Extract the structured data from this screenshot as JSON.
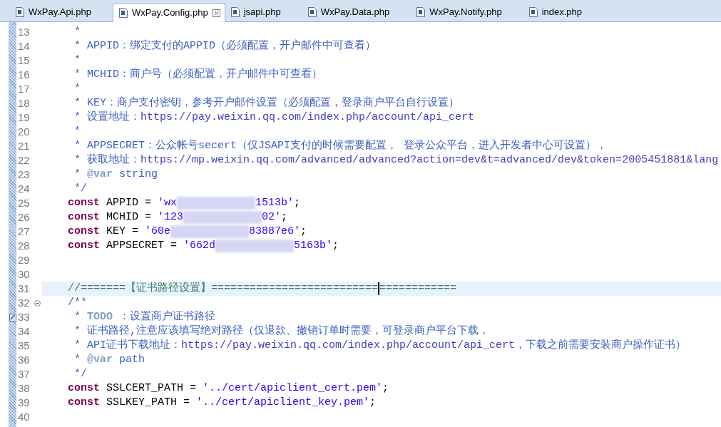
{
  "tabs": [
    {
      "label": "WxPay.Api.php",
      "selected": false
    },
    {
      "label": "WxPay.Config.php",
      "selected": true
    },
    {
      "label": "jsapi.php",
      "selected": false
    },
    {
      "label": "WxPay.Data.php",
      "selected": false
    },
    {
      "label": "WxPay.Notify.php",
      "selected": false
    },
    {
      "label": "index.php",
      "selected": false
    }
  ],
  "lines": [
    {
      "number": "13",
      "kind": "doc",
      "current": false,
      "task": false,
      "tokens": [
        {
          "kind": "doc",
          "text": "*"
        }
      ]
    },
    {
      "number": "14",
      "kind": "doc",
      "current": false,
      "task": false,
      "tokens": [
        {
          "kind": "doc",
          "text": "* APPID：绑定支付的APPID（必须配置，开户邮件中可查看）"
        }
      ]
    },
    {
      "number": "15",
      "kind": "doc",
      "current": false,
      "task": false,
      "tokens": [
        {
          "kind": "doc",
          "text": "*"
        }
      ]
    },
    {
      "number": "16",
      "kind": "doc",
      "current": false,
      "task": false,
      "tokens": [
        {
          "kind": "doc",
          "text": "* MCHID：商户号（必须配置，开户邮件中可查看）"
        }
      ]
    },
    {
      "number": "17",
      "kind": "doc",
      "current": false,
      "task": false,
      "tokens": [
        {
          "kind": "doc",
          "text": "*"
        }
      ]
    },
    {
      "number": "18",
      "kind": "doc",
      "current": false,
      "task": false,
      "tokens": [
        {
          "kind": "doc",
          "text": "* KEY：商户支付密钥，参考开户邮件设置（必须配置，登录商户平台自行设置）"
        }
      ]
    },
    {
      "number": "19",
      "kind": "doc",
      "current": false,
      "task": false,
      "tokens": [
        {
          "kind": "doc",
          "text": "* 设置地址："
        },
        {
          "kind": "url",
          "text": "https://pay.weixin.qq.com/index.php/account/api_cert"
        }
      ]
    },
    {
      "number": "20",
      "kind": "doc",
      "current": false,
      "task": false,
      "tokens": [
        {
          "kind": "doc",
          "text": "*"
        }
      ]
    },
    {
      "number": "21",
      "kind": "doc",
      "current": false,
      "task": false,
      "tokens": [
        {
          "kind": "doc",
          "text": "* APPSECRET：公众帐号secert（仅JSAPI支付的时候需要配置， 登录公众平台，进入开发者中心可设置），"
        }
      ]
    },
    {
      "number": "22",
      "kind": "doc",
      "current": false,
      "task": false,
      "tokens": [
        {
          "kind": "doc",
          "text": "* 获取地址："
        },
        {
          "kind": "url",
          "text": "https://mp.weixin.qq.com/advanced/advanced?action=dev&t=advanced/dev&token=2005451881&lang"
        }
      ]
    },
    {
      "number": "23",
      "kind": "doc",
      "current": false,
      "task": false,
      "tokens": [
        {
          "kind": "doc",
          "text": "*"
        },
        {
          "kind": "tag",
          "text": "@var"
        },
        {
          "kind": "doc",
          "text": "string"
        }
      ]
    },
    {
      "number": "24",
      "kind": "doc",
      "current": false,
      "task": false,
      "tokens": [
        {
          "kind": "doc",
          "text": "*/"
        }
      ]
    },
    {
      "number": "25",
      "kind": "code",
      "current": false,
      "task": false,
      "tokens": [
        {
          "kind": "keyword",
          "text": "const"
        },
        {
          "kind": "plain",
          "text": " APPID = "
        },
        {
          "kind": "string",
          "text": "'wx"
        },
        {
          "kind": "redacted"
        },
        {
          "kind": "string",
          "text": "1513b'"
        },
        {
          "kind": "plain",
          "text": ";"
        }
      ]
    },
    {
      "number": "26",
      "kind": "code",
      "current": false,
      "task": false,
      "tokens": [
        {
          "kind": "keyword",
          "text": "const"
        },
        {
          "kind": "plain",
          "text": " MCHID = "
        },
        {
          "kind": "string",
          "text": "'123"
        },
        {
          "kind": "redacted"
        },
        {
          "kind": "string",
          "text": "02'"
        },
        {
          "kind": "plain",
          "text": ";"
        }
      ]
    },
    {
      "number": "27",
      "kind": "code",
      "current": false,
      "task": false,
      "tokens": [
        {
          "kind": "keyword",
          "text": "const"
        },
        {
          "kind": "plain",
          "text": " KEY = "
        },
        {
          "kind": "string",
          "text": "'60e"
        },
        {
          "kind": "redacted"
        },
        {
          "kind": "string",
          "text": "83887e6'"
        },
        {
          "kind": "plain",
          "text": ";"
        }
      ]
    },
    {
      "number": "28",
      "kind": "code",
      "current": false,
      "task": false,
      "tokens": [
        {
          "kind": "keyword",
          "text": "const"
        },
        {
          "kind": "plain",
          "text": " APPSECRET = "
        },
        {
          "kind": "string",
          "text": "'662d"
        },
        {
          "kind": "redacted"
        },
        {
          "kind": "string",
          "text": "5163b'"
        },
        {
          "kind": "plain",
          "text": ";"
        }
      ]
    },
    {
      "number": "29",
      "kind": "code",
      "current": false,
      "task": false
    },
    {
      "number": "30",
      "kind": "code",
      "current": false,
      "task": false
    },
    {
      "number": "31",
      "kind": "code",
      "current": true,
      "task": false,
      "tokens": [
        {
          "kind": "comment",
          "text": "//=======【证书路径设置】=========================="
        },
        {
          "kind": "caret"
        },
        {
          "kind": "comment",
          "text": "============"
        }
      ]
    },
    {
      "number": "32",
      "kind": "code",
      "current": false,
      "task": false,
      "fold_expanded": true,
      "tokens": [
        {
          "kind": "doc",
          "text": "/**"
        }
      ]
    },
    {
      "number": "33",
      "kind": "doc",
      "current": false,
      "task": true,
      "tokens": [
        {
          "kind": "doc",
          "text": "*"
        },
        {
          "kind": "tag",
          "text": "TODO"
        },
        {
          "kind": "doc",
          "text": "：设置商户证书路径"
        }
      ]
    },
    {
      "number": "34",
      "kind": "doc",
      "current": false,
      "task": false,
      "tokens": [
        {
          "kind": "doc",
          "text": "* 证书路径,注意应该填写绝对路径（仅退款、撤销订单时需要，可登录商户平台下载，"
        }
      ]
    },
    {
      "number": "35",
      "kind": "doc",
      "current": false,
      "task": false,
      "tokens": [
        {
          "kind": "doc",
          "text": "* API证书下载地址："
        },
        {
          "kind": "url",
          "text": "https://pay.weixin.qq.com/index.php/account/api_cert"
        },
        {
          "kind": "doc",
          "text": "，下载之前需要安装商户操作证书）"
        }
      ]
    },
    {
      "number": "36",
      "kind": "doc",
      "current": false,
      "task": false,
      "tokens": [
        {
          "kind": "doc",
          "text": "*"
        },
        {
          "kind": "tag",
          "text": "@var"
        },
        {
          "kind": "doc",
          "text": "path"
        }
      ]
    },
    {
      "number": "37",
      "kind": "doc",
      "current": false,
      "task": false,
      "tokens": [
        {
          "kind": "doc",
          "text": "*/"
        }
      ]
    },
    {
      "number": "38",
      "kind": "code",
      "current": false,
      "task": false,
      "tokens": [
        {
          "kind": "keyword",
          "text": "const"
        },
        {
          "kind": "plain",
          "text": " SSLCERT_PATH = "
        },
        {
          "kind": "string",
          "text": "'../cert/apiclient_cert.pem'"
        },
        {
          "kind": "plain",
          "text": ";"
        }
      ]
    },
    {
      "number": "39",
      "kind": "code",
      "current": false,
      "task": false,
      "tokens": [
        {
          "kind": "keyword",
          "text": "const"
        },
        {
          "kind": "plain",
          "text": " SSLKEY_PATH = "
        },
        {
          "kind": "string",
          "text": "'../cert/apiclient_key.pem'"
        },
        {
          "kind": "plain",
          "text": ";"
        }
      ]
    },
    {
      "number": "40",
      "kind": "code",
      "current": false,
      "task": false
    }
  ]
}
